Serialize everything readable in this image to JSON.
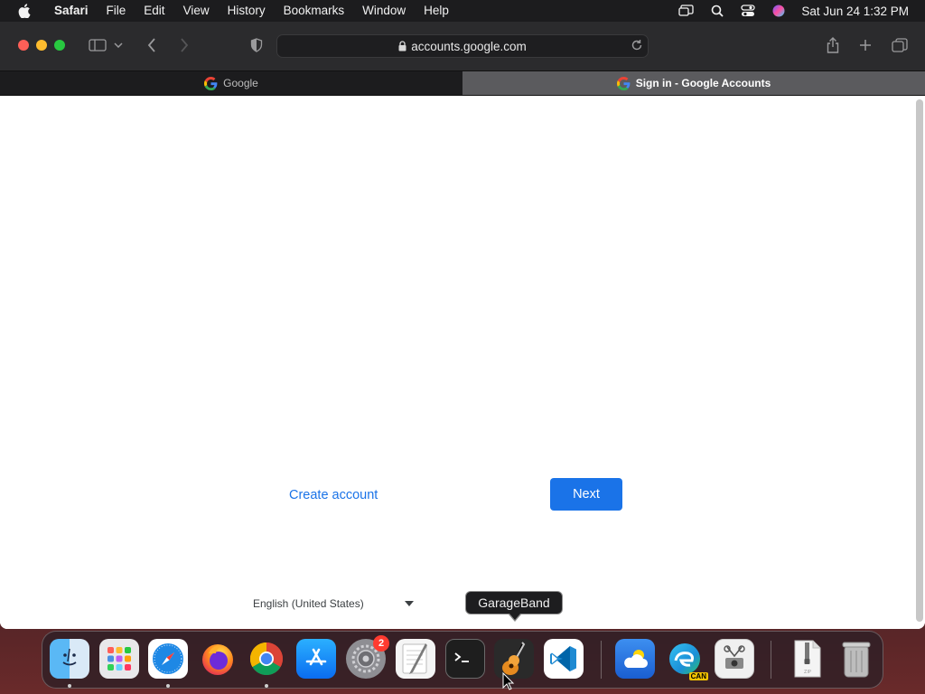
{
  "menubar": {
    "app_name": "Safari",
    "items": [
      "File",
      "Edit",
      "View",
      "History",
      "Bookmarks",
      "Window",
      "Help"
    ],
    "clock": "Sat Jun 24  1:32 PM"
  },
  "browser": {
    "url": "accounts.google.com",
    "tabs": [
      {
        "label": "Google",
        "active": false
      },
      {
        "label": "Sign in - Google Accounts",
        "active": true
      }
    ]
  },
  "page": {
    "create_account": "Create account",
    "next": "Next",
    "language": "English (United States)"
  },
  "dock": {
    "tooltip": "GarageBand",
    "settings_badge": "2",
    "edge_tag": "CAN",
    "apps": [
      "Finder",
      "Launchpad",
      "Safari",
      "Firefox",
      "Chrome",
      "App Store",
      "System Settings",
      "TextEdit",
      "Terminal",
      "GarageBand",
      "Visual Studio Code",
      "Weather",
      "Microsoft Edge Canary",
      "Screenshot",
      "Archive",
      "Trash"
    ]
  },
  "colors": {
    "accent": "#1a73e8",
    "menubar_bg": "#1c1c1e",
    "toolbar_bg": "#2b2b2d"
  }
}
